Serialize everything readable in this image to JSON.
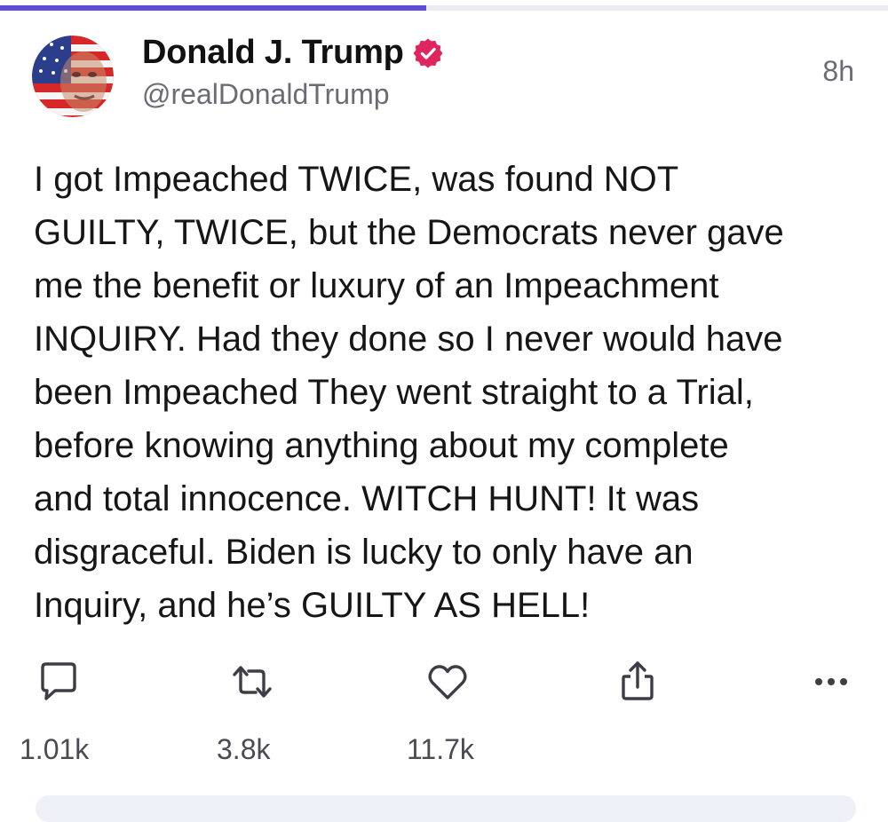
{
  "progress": {
    "fraction": 0.48,
    "color": "#5c4fd6"
  },
  "author": {
    "display_name": "Donald J. Trump",
    "handle": "@realDonaldTrump",
    "verified": true,
    "verified_color": "#e0245e"
  },
  "post": {
    "time_ago": "8h",
    "text": "I got Impeached TWICE, was found NOT\nGUILTY, TWICE, but the Democrats never gave\nme the benefit or luxury of an Impeachment\nINQUIRY. Had they done so I never would have\nbeen Impeached They went straight to a Trial,\nbefore knowing anything about my complete\nand total innocence. WITCH HUNT! It was\ndisgraceful. Biden is lucky to only have an\nInquiry, and he’s GUILTY AS HELL!"
  },
  "actions": {
    "replies": {
      "icon": "comment-icon",
      "count": "1.01k"
    },
    "reposts": {
      "icon": "repost-icon",
      "count": "3.8k"
    },
    "likes": {
      "icon": "heart-icon",
      "count": "11.7k"
    },
    "share": {
      "icon": "share-icon"
    },
    "more": {
      "icon": "more-dots-icon"
    }
  }
}
